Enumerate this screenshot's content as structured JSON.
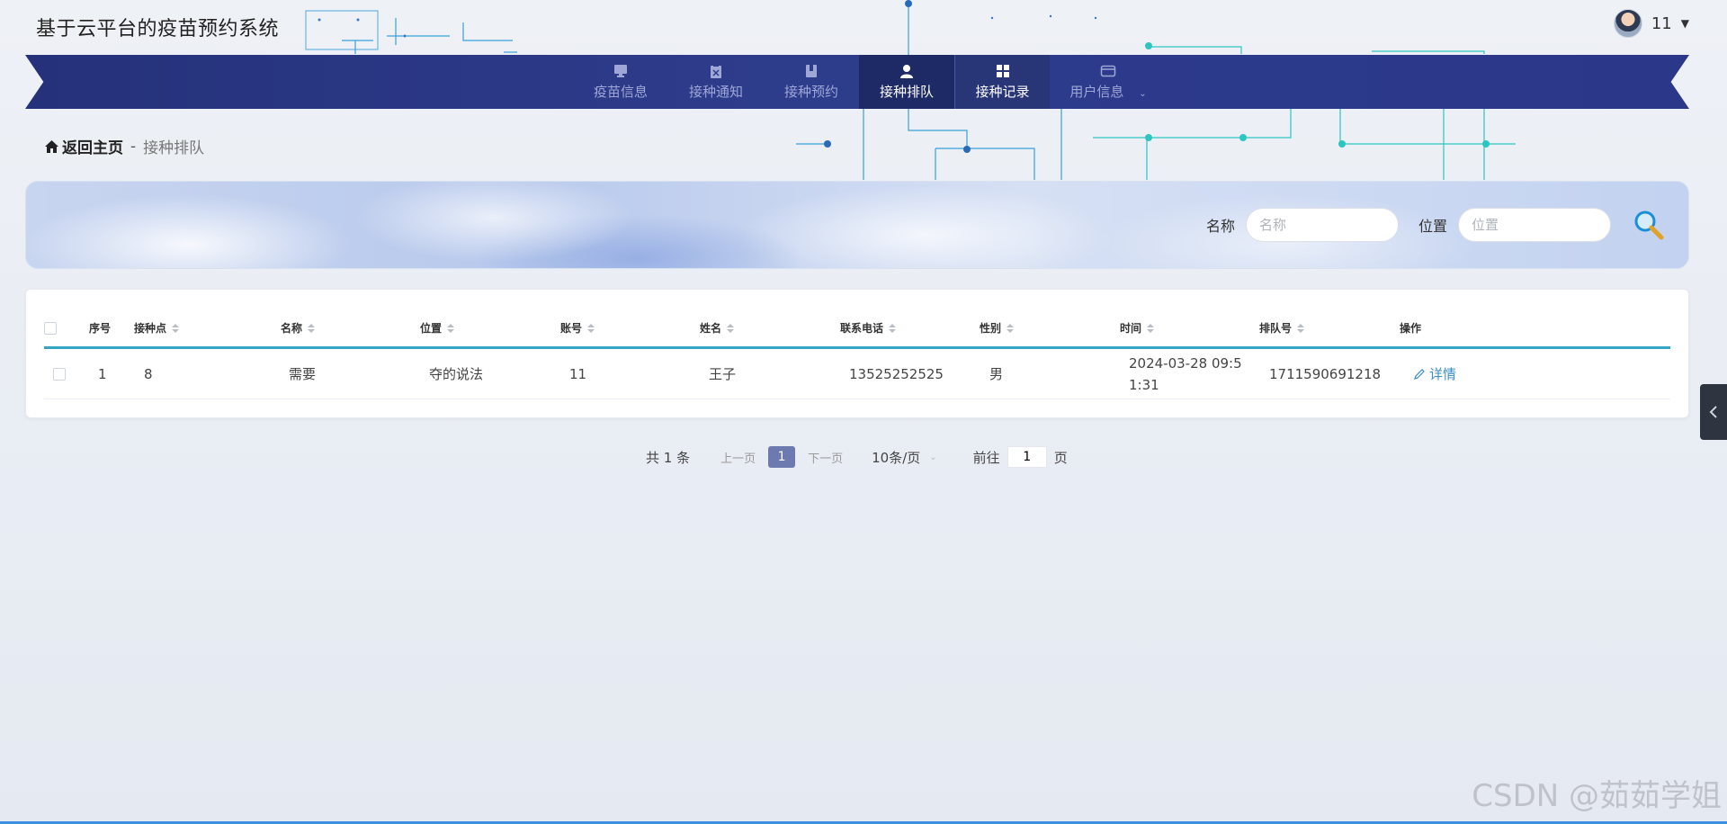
{
  "app": {
    "title": "基于云平台的疫苗预约系统"
  },
  "user": {
    "name": "11"
  },
  "nav": {
    "items": [
      {
        "label": "疫苗信息",
        "icon": "monitor-icon"
      },
      {
        "label": "接种通知",
        "icon": "clipboard-icon"
      },
      {
        "label": "接种预约",
        "icon": "book-icon"
      },
      {
        "label": "接种排队",
        "icon": "user-icon"
      },
      {
        "label": "接种记录",
        "icon": "grid-icon"
      },
      {
        "label": "用户信息",
        "icon": "wallet-icon"
      }
    ],
    "active": "接种排队"
  },
  "breadcrumb": {
    "home": "返回主页",
    "separator": "-",
    "current": "接种排队"
  },
  "search": {
    "name_label": "名称",
    "name_placeholder": "名称",
    "position_label": "位置",
    "position_placeholder": "位置"
  },
  "table": {
    "columns": [
      "序号",
      "接种点",
      "名称",
      "位置",
      "账号",
      "姓名",
      "联系电话",
      "性别",
      "时间",
      "排队号",
      "操作"
    ],
    "rows": [
      {
        "index": "1",
        "site": "8",
        "name": "需要",
        "position": "夺的说法",
        "account": "11",
        "person": "王子",
        "phone": "13525252525",
        "gender": "男",
        "time": "2024-03-28 09:51:31",
        "queue_no": "1711590691218",
        "action": "详情"
      }
    ]
  },
  "pagination": {
    "total": "共 1 条",
    "prev": "上一页",
    "current": "1",
    "next": "下一页",
    "page_size": "10条/页",
    "goto_label": "前往",
    "goto_value": "1",
    "goto_suffix": "页"
  },
  "watermark": "CSDN @茹茹学姐",
  "colors": {
    "nav_bg": "#2e3c8c",
    "accent": "#35a5c5",
    "link": "#3a8ec2"
  }
}
